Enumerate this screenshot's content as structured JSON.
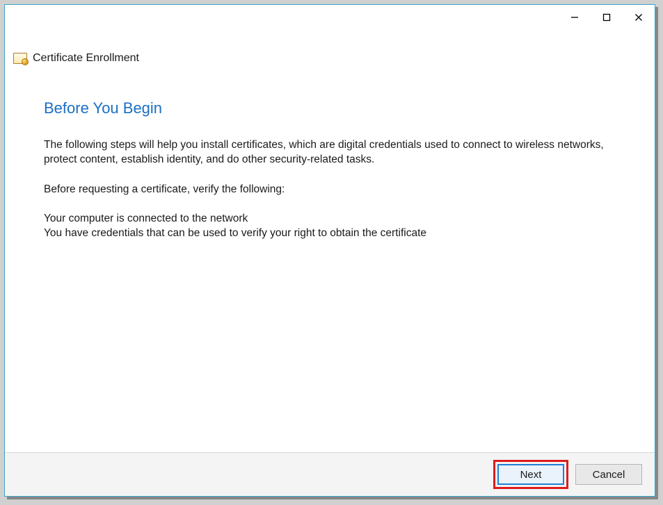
{
  "window": {
    "app_title": "Certificate Enrollment"
  },
  "page": {
    "heading": "Before You Begin",
    "intro": "The following steps will help you install certificates, which are digital credentials used to connect to wireless networks, protect content, establish identity, and do other security-related tasks.",
    "verify_prompt": "Before requesting a certificate, verify the following:",
    "check1": "Your computer is connected to the network",
    "check2": "You have credentials that can be used to verify your right to obtain the certificate"
  },
  "footer": {
    "next_label": "Next",
    "cancel_label": "Cancel"
  }
}
